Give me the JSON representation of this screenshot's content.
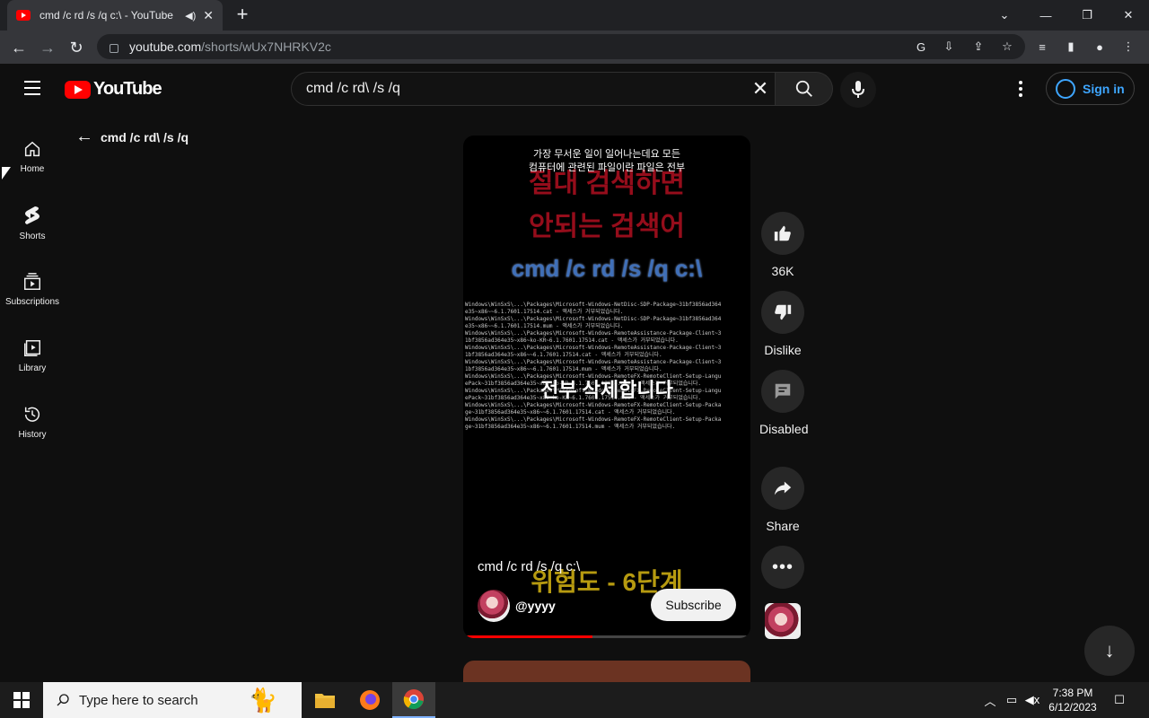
{
  "browser": {
    "tab_title": "cmd /c rd /s /q c:\\ - YouTube",
    "url_host": "youtube.com",
    "url_path": "/shorts/wUx7NHRKV2c"
  },
  "youtube": {
    "logo_text": "YouTube",
    "search_value": "cmd /c rd\\ /s /q",
    "signin_label": "Sign in",
    "sidebar": [
      {
        "label": "Home"
      },
      {
        "label": "Shorts"
      },
      {
        "label": "Subscriptions"
      },
      {
        "label": "Library"
      },
      {
        "label": "History"
      }
    ],
    "page_title": "cmd /c rd\\ /s /q"
  },
  "short": {
    "caption_line1": "가장 무서운 일이 일어나는데요 모든",
    "caption_line2": "컴퓨터에 관련된 파일이란 파일은 전부",
    "red_line1": "절대 검색하면",
    "red_line2": "안되는 검색어",
    "command_text": "cmd /c rd /s /q c:\\",
    "overlay_text": "전부 삭제합니다",
    "yellow_text": "위험도 - 6단계",
    "video_title": "cmd /c rd /s /q c:\\",
    "channel_name": "@yyyy",
    "subscribe_label": "Subscribe",
    "progress": 0.45,
    "console_lines": [
      "Windows\\WinSxS\\...\\Packages\\Microsoft-Windows-NetDisc-SDP-Package~31bf3856ad364",
      "e35~x86~~6.1.7601.17514.cat - 액세스가 거부되었습니다.",
      "Windows\\WinSxS\\...\\Packages\\Microsoft-Windows-NetDisc-SDP-Package~31bf3856ad364",
      "e35~x86~~6.1.7601.17514.mum - 액세스가 거부되었습니다.",
      "Windows\\WinSxS\\...\\Packages\\Microsoft-Windows-RemoteAssistance-Package-Client~3",
      "1bf3856ad364e35~x86~ko-KR~6.1.7601.17514.cat - 액세스가 거부되었습니다.",
      "Windows\\WinSxS\\...\\Packages\\Microsoft-Windows-RemoteAssistance-Package-Client~3",
      "1bf3856ad364e35~x86~~6.1.7601.17514.cat - 액세스가 거부되었습니다.",
      "Windows\\WinSxS\\...\\Packages\\Microsoft-Windows-RemoteAssistance-Package-Client~3",
      "1bf3856ad364e35~x86~~6.1.7601.17514.mum - 액세스가 거부되었습니다.",
      "Windows\\WinSxS\\...\\Packages\\Microsoft-Windows-RemoteFX-RemoteClient-Setup-Langu",
      "ePack~31bf3856ad364e35~x86~ko-KR~6.1.7601.17514.cat - 액세스가 거부되었습니다.",
      "Windows\\WinSxS\\...\\Packages\\Microsoft-Windows-RemoteFX-RemoteClient-Setup-Langu",
      "ePack~31bf3856ad364e35~x86~ko-KR~6.1.7601.17514.mum - 액세스가 거부되었습니다.",
      "Windows\\WinSxS\\...\\Packages\\Microsoft-Windows-RemoteFX-RemoteClient-Setup-Packa",
      "ge~31bf3856ad364e35~x86~~6.1.7601.17514.cat - 액세스가 거부되었습니다.",
      "Windows\\WinSxS\\...\\Packages\\Microsoft-Windows-RemoteFX-RemoteClient-Setup-Packa",
      "ge~31bf3856ad364e35~x86~~6.1.7601.17514.mum - 액세스가 거부되었습니다."
    ]
  },
  "actions": {
    "like_count": "36K",
    "dislike_label": "Dislike",
    "comments_label": "Disabled",
    "share_label": "Share"
  },
  "taskbar": {
    "search_placeholder": "Type here to search",
    "time": "7:38 PM",
    "date": "6/12/2023"
  },
  "colors": {
    "youtube_red": "#ff0000",
    "link_blue": "#3ea6ff",
    "background": "#0f0f0f"
  }
}
